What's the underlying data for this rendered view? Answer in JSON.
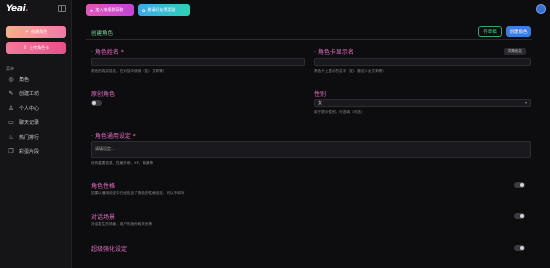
{
  "sidebar": {
    "logo_main": "Yeai",
    "logo_dot": ".",
    "btn_create_label": "创建角色",
    "btn_upload_label": "上传角色卡",
    "section_label": "菜单",
    "items": [
      {
        "label": "角色",
        "icon": "compass-icon",
        "glyph": "◎"
      },
      {
        "label": "创建工坊",
        "icon": "wrench-icon",
        "glyph": "✎"
      },
      {
        "label": "个人中心",
        "icon": "user-icon",
        "glyph": "♙"
      },
      {
        "label": "聊天记录",
        "icon": "chat-icon",
        "glyph": "▭"
      },
      {
        "label": "热门排行",
        "icon": "flame-icon",
        "glyph": "♨"
      },
      {
        "label": "彩蛋片段",
        "icon": "bookmark-icon",
        "glyph": "❐"
      }
    ]
  },
  "topbar": {
    "btn1_label": "加入电报群获取",
    "btn2_label": "邀请好友得奖励"
  },
  "header": {
    "title": "创建角色",
    "save_label": "存草稿",
    "create_label": "创建角色"
  },
  "form": {
    "name_label": "· 角色姓名",
    "name_req": "*",
    "name_hint": "角色的真实姓名，在对话中使用（如：艾莉等）",
    "display_label": "· 角色卡显示名",
    "display_hint": "角色卡上显示的名字（如：魔法少女艾莉等）",
    "tag_btn": "同角色名",
    "contrib_label": "原创角色",
    "gender_label": "性别",
    "gender_value": "女",
    "gender_hint": "用于提示性别，可选填（可选）",
    "setting_label": "· 角色通用设定",
    "setting_req": "*",
    "setting_placeholder": "请填设定...",
    "setting_hint": "设有重要信息，性格外貌，XP，背景等",
    "personality_label": "角色性格",
    "personality_hint": "如果以通用设定中已经包含了角色的性格设定，可以不填写",
    "scene_label": "对话场景",
    "scene_hint": "对话发生的场景，用户的身份和关系等",
    "advanced_label": "超级强化设定"
  }
}
